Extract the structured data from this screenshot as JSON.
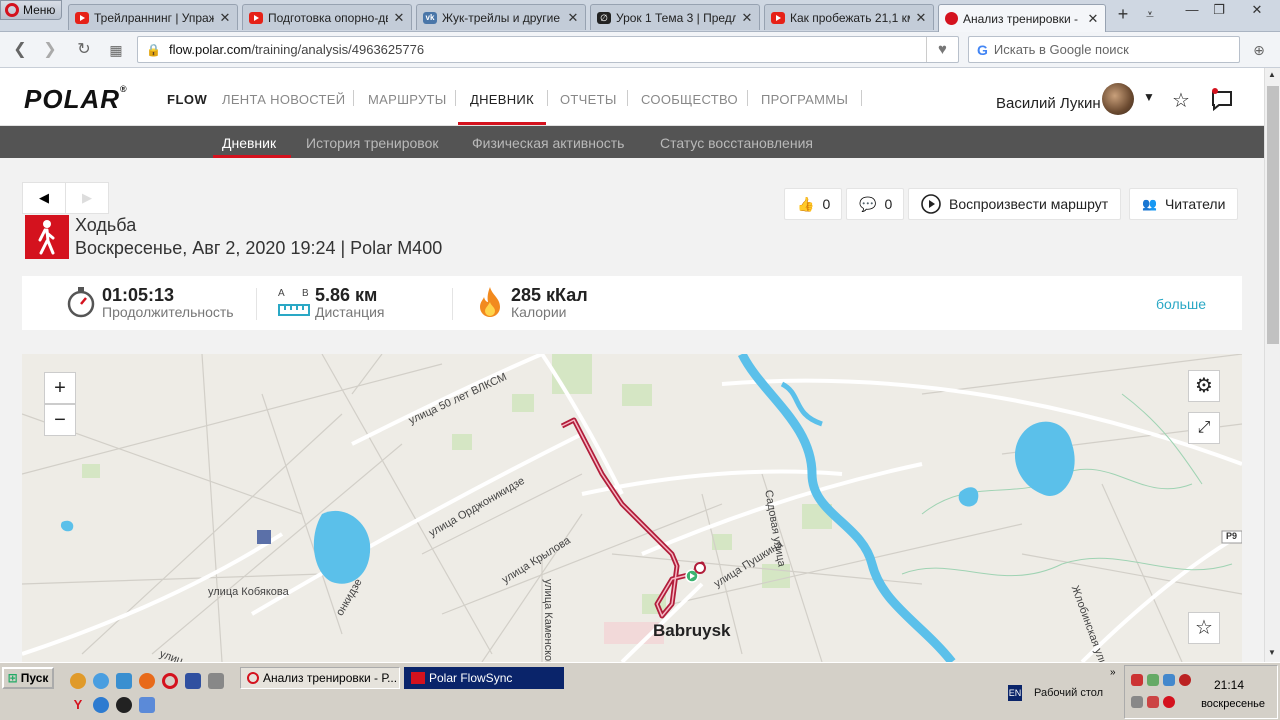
{
  "browser": {
    "menu_label": "Меню",
    "tabs": [
      {
        "title": "Трейлраннинг | Упражн",
        "favicon": "youtube-icon"
      },
      {
        "title": "Подготовка опорно-дви",
        "favicon": "youtube-icon"
      },
      {
        "title": "Жук-трейлы и другие",
        "favicon": "vk-icon"
      },
      {
        "title": "Урок 1 Тема 3 | Предло",
        "favicon": "site-icon"
      },
      {
        "title": "Как пробежать 21,1 км",
        "favicon": "youtube-icon"
      },
      {
        "title": "Анализ тренировки - Ро",
        "favicon": "polar-icon"
      }
    ],
    "new_tab": "+",
    "url_host": "flow.polar.com",
    "url_path": "/training/analysis/4963625776",
    "search_placeholder": "Искать в Google поиск"
  },
  "polar": {
    "logo": "POLAR",
    "logo_mark": "®",
    "product": "FLOW",
    "nav": [
      "ЛЕНТА НОВОСТЕЙ",
      "МАРШРУТЫ",
      "ДНЕВНИК",
      "ОТЧЕТЫ",
      "СООБЩЕСТВО",
      "ПРОГРАММЫ"
    ],
    "user_name": "Василий Лукин",
    "subnav": [
      "Дневник",
      "История тренировок",
      "Физическая активность",
      "Статус восстановления"
    ]
  },
  "session": {
    "sport": "Ходьба",
    "info": "Воскресенье, Авг 2, 2020 19:24 | Polar M400",
    "likes": "0",
    "comments": "0",
    "replay_label": "Воспроизвести маршрут",
    "followers_label": "Читатели",
    "duration_value": "01:05:13",
    "duration_label": "Продолжительность",
    "distance_value": "5.86 км",
    "distance_label": "Дистанция",
    "distance_icon_a": "A",
    "distance_icon_b": "B",
    "calories_value": "285 кКал",
    "calories_label": "Калории",
    "more_label": "больше"
  },
  "map": {
    "labels": [
      "улица 50 лет ВЛКСМ",
      "улица Орджоникидзе",
      "улица Крылова",
      "улица Пушкина",
      "Садовая улица",
      "улица Кобякова",
      "улица Каменского",
      "Жлобинская улица",
      "онкидзе",
      "улиц",
      "P9"
    ],
    "city": "Babruysk",
    "zoom_in": "+",
    "zoom_out": "−"
  },
  "taskbar": {
    "start_label": "Пуск",
    "tasks": [
      "Анализ тренировки - Р...",
      "Polar FlowSync"
    ],
    "lang": "EN",
    "desktop_label": "Рабочий стол",
    "time": "21:14",
    "day": "воскресенье"
  },
  "colors": {
    "brand_red": "#d4121e",
    "link": "#2aa8c5",
    "water": "#5bc0ea",
    "route": "#b11d3a"
  }
}
